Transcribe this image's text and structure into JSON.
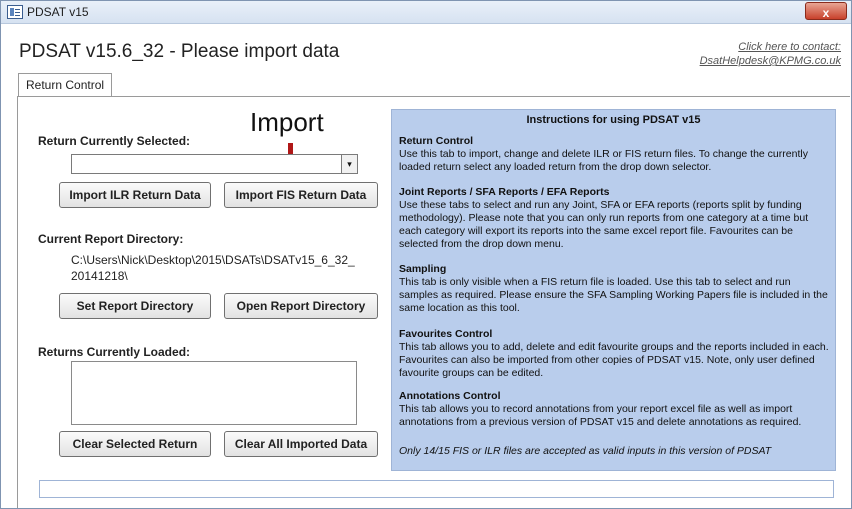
{
  "window": {
    "title": "PDSAT v15",
    "close_glyph": "x"
  },
  "header": {
    "form_title": "PDSAT v15.6_32 - Please import data",
    "contact_label": "Click here to contact:",
    "contact_email": "DsatHelpdesk@KPMG.co.uk"
  },
  "tabs": [
    {
      "label": "Return Control"
    }
  ],
  "return_control": {
    "selected_label": "Return Currently Selected:",
    "annotation": "Import",
    "combo_value": "",
    "combo_arrow": "▾",
    "import_ilr_label": "Import ILR Return Data",
    "import_fis_label": "Import FIS Return Data",
    "directory_label": "Current Report Directory:",
    "directory_path": "C:\\Users\\Nick\\Desktop\\2015\\DSATs\\DSATv15_6_32_20141218\\",
    "set_directory_label": "Set Report Directory",
    "open_directory_label": "Open Report Directory",
    "loaded_label": "Returns Currently Loaded:",
    "clear_selected_label": "Clear Selected Return",
    "clear_all_label": "Clear All Imported Data"
  },
  "instructions": {
    "title": "Instructions for using PDSAT v15",
    "sections": [
      {
        "heading": "Return Control",
        "body": "Use this tab to import, change and delete ILR or FIS return files. To change the currently loaded return select any loaded return from the drop down selector."
      },
      {
        "heading": "Joint Reports / SFA Reports / EFA Reports",
        "body": "Use these tabs to select and run any Joint, SFA or EFA reports (reports split by funding methodology). Please note that you can only run reports from one category at a time but each category will export its reports into the same excel report file. Favourites can be selected from the drop down menu."
      },
      {
        "heading": "Sampling",
        "body": "This tab is only visible when a FIS return file is loaded. Use this tab to select and run samples as required. Please ensure the SFA Sampling Working Papers file is included in the same location as this tool."
      },
      {
        "heading": "Favourites Control",
        "body": "This tab allows you to add, delete and edit favourite groups and the reports included in each. Favourites can also be imported from other copies of PDSAT v15. Note, only user defined favourite groups can be edited."
      },
      {
        "heading": "Annotations Control",
        "body": "This tab allows you to record annotations from your report excel file as well as import annotations from a previous version of PDSAT v15 and delete annotations as required."
      }
    ],
    "footer": "Only 14/15 FIS or ILR files are accepted as valid inputs in this version of PDSAT"
  },
  "status_bar": {
    "text": ""
  },
  "colors": {
    "instructions_background": "#b9cdec",
    "annotation_arrow": "#b01717",
    "close_button": "#c8412b"
  }
}
